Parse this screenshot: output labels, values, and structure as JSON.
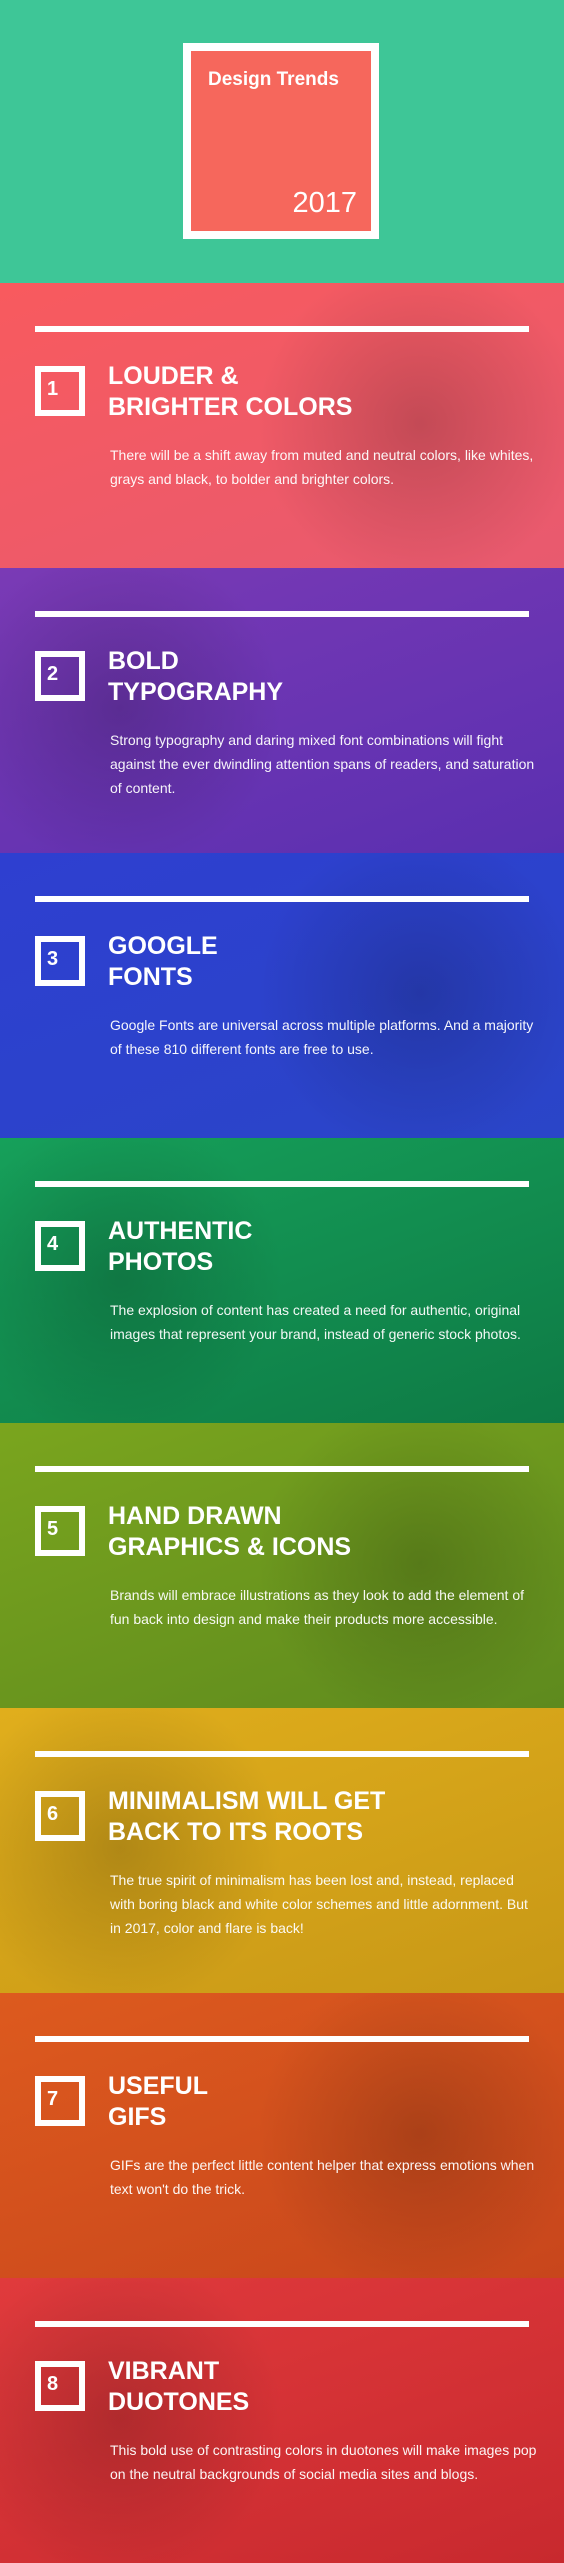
{
  "header": {
    "title": "Design Trends",
    "year": "2017",
    "background": "#3ec697",
    "card_color": "#f6675c"
  },
  "sections": [
    {
      "number": "1",
      "title": "LOUDER &\nBRIGHTER COLORS",
      "body": "There will be a shift away from muted and neutral colors, like whites, grays and black, to bolder and brighter colors.",
      "color_top": "#f85a5e",
      "color_bottom": "#e85a6f"
    },
    {
      "number": "2",
      "title": "BOLD\nTYPOGRAPHY",
      "body": "Strong typography and daring mixed font combinations will fight against the ever dwindling attention spans of readers, and saturation of content.",
      "color_top": "#7a3ab5",
      "color_bottom": "#5a2fb0"
    },
    {
      "number": "3",
      "title": "GOOGLE\nFONTS",
      "body": "Google Fonts are universal across multiple platforms. And a majority of these 810 different fonts are free to use.",
      "color_top": "#2e3fd0",
      "color_bottom": "#2a45c8"
    },
    {
      "number": "4",
      "title": "AUTHENTIC\nPHOTOS",
      "body": "The explosion of content has created a need for authentic, original images that represent your brand, instead of generic stock photos.",
      "color_top": "#16a05a",
      "color_bottom": "#0e7a45"
    },
    {
      "number": "5",
      "title": "HAND DRAWN\nGRAPHICS & ICONS",
      "body": "Brands will embrace illustrations as they look to add the element of fun back into design and make their products more accessible.",
      "color_top": "#7aa51e",
      "color_bottom": "#5e8a1e"
    },
    {
      "number": "6",
      "title": "MINIMALISM WILL GET\nBACK TO ITS ROOTS",
      "body": "The true spirit of minimalism has been lost and, instead, replaced with boring black and white color schemes and little adornment. But in 2017, color and flare is back!",
      "color_top": "#e0ae1c",
      "color_bottom": "#c89816"
    },
    {
      "number": "7",
      "title": "USEFUL\nGIFS",
      "body": "GIFs are the perfect little content helper that express emotions when text won't do the trick.",
      "color_top": "#dd5a1e",
      "color_bottom": "#c8461c"
    },
    {
      "number": "8",
      "title": "VIBRANT\nDUOTONES",
      "body": "This bold use of contrasting colors in duotones will make images pop on the neutral backgrounds of social media sites and blogs.",
      "color_top": "#e03a3c",
      "color_bottom": "#c8292e"
    }
  ]
}
